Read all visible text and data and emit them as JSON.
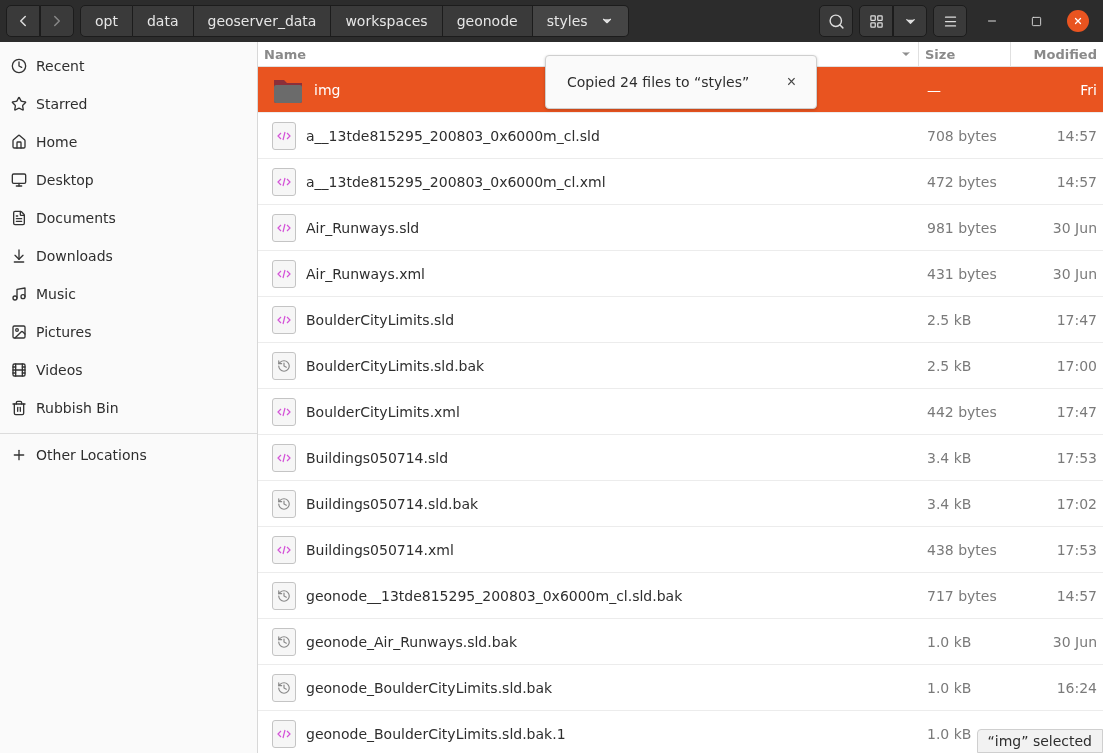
{
  "breadcrumb": [
    {
      "label": "opt",
      "selected": false
    },
    {
      "label": "data",
      "selected": false
    },
    {
      "label": "geoserver_data",
      "selected": false
    },
    {
      "label": "workspaces",
      "selected": false
    },
    {
      "label": "geonode",
      "selected": false
    },
    {
      "label": "styles",
      "selected": true
    }
  ],
  "sidebar": {
    "items": [
      {
        "label": "Recent"
      },
      {
        "label": "Starred"
      },
      {
        "label": "Home"
      },
      {
        "label": "Desktop"
      },
      {
        "label": "Documents"
      },
      {
        "label": "Downloads"
      },
      {
        "label": "Music"
      },
      {
        "label": "Pictures"
      },
      {
        "label": "Videos"
      },
      {
        "label": "Rubbish Bin"
      }
    ],
    "other": {
      "label": "Other Locations"
    }
  },
  "table": {
    "columns": [
      "Name",
      "Size",
      "Modified"
    ],
    "rows": [
      {
        "kind": "folder",
        "name": "img",
        "size": "—",
        "modified": "Fri",
        "selected": true
      },
      {
        "kind": "code",
        "name": "a__13tde815295_200803_0x6000m_cl.sld",
        "size": "708 bytes",
        "modified": "14:57",
        "selected": false
      },
      {
        "kind": "code",
        "name": "a__13tde815295_200803_0x6000m_cl.xml",
        "size": "472 bytes",
        "modified": "14:57",
        "selected": false
      },
      {
        "kind": "code",
        "name": "Air_Runways.sld",
        "size": "981 bytes",
        "modified": "30 Jun",
        "selected": false
      },
      {
        "kind": "code",
        "name": "Air_Runways.xml",
        "size": "431 bytes",
        "modified": "30 Jun",
        "selected": false
      },
      {
        "kind": "code",
        "name": "BoulderCityLimits.sld",
        "size": "2.5 kB",
        "modified": "17:47",
        "selected": false
      },
      {
        "kind": "backup",
        "name": "BoulderCityLimits.sld.bak",
        "size": "2.5 kB",
        "modified": "17:00",
        "selected": false
      },
      {
        "kind": "code",
        "name": "BoulderCityLimits.xml",
        "size": "442 bytes",
        "modified": "17:47",
        "selected": false
      },
      {
        "kind": "code",
        "name": "Buildings050714.sld",
        "size": "3.4 kB",
        "modified": "17:53",
        "selected": false
      },
      {
        "kind": "backup",
        "name": "Buildings050714.sld.bak",
        "size": "3.4 kB",
        "modified": "17:02",
        "selected": false
      },
      {
        "kind": "code",
        "name": "Buildings050714.xml",
        "size": "438 bytes",
        "modified": "17:53",
        "selected": false
      },
      {
        "kind": "backup",
        "name": "geonode__13tde815295_200803_0x6000m_cl.sld.bak",
        "size": "717 bytes",
        "modified": "14:57",
        "selected": false
      },
      {
        "kind": "backup",
        "name": "geonode_Air_Runways.sld.bak",
        "size": "1.0 kB",
        "modified": "30 Jun",
        "selected": false
      },
      {
        "kind": "backup",
        "name": "geonode_BoulderCityLimits.sld.bak",
        "size": "1.0 kB",
        "modified": "16:24",
        "selected": false
      },
      {
        "kind": "code",
        "name": "geonode_BoulderCityLimits.sld.bak.1",
        "size": "1.0 kB",
        "selected": false
      }
    ]
  },
  "notification": {
    "message": "Copied 24 files to “styles”",
    "close": "×"
  },
  "status": "“img” selected"
}
